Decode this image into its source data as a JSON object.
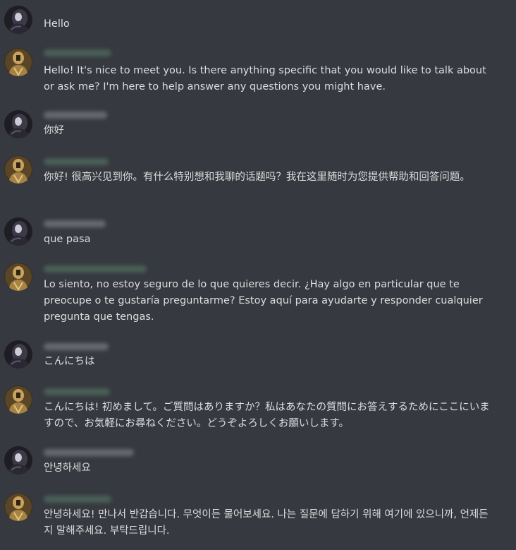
{
  "conversation": {
    "messages": [
      {
        "role": "user",
        "avatar_icon": "dark-hooded-figure-avatar",
        "text": "Hello"
      },
      {
        "role": "bot",
        "avatar_icon": "golden-armored-figure-avatar",
        "text": "Hello! It's nice to meet you. Is there anything specific that you would like to talk about or ask me? I'm here to help answer any questions you might have."
      },
      {
        "role": "user",
        "avatar_icon": "dark-hooded-figure-avatar",
        "text": "你好"
      },
      {
        "role": "bot",
        "avatar_icon": "golden-armored-figure-avatar",
        "text": "你好! 很高兴见到你。有什么特别想和我聊的话题吗？我在这里随时为您提供帮助和回答问题。"
      },
      {
        "role": "user",
        "avatar_icon": "dark-hooded-figure-avatar",
        "text": "que pasa"
      },
      {
        "role": "bot",
        "avatar_icon": "golden-armored-figure-avatar",
        "text": "Lo siento, no estoy seguro de lo que quieres decir. ¿Hay algo en particular que te preocupe o te gustaría preguntarme? Estoy aquí para ayudarte y responder cualquier pregunta que tengas."
      },
      {
        "role": "user",
        "avatar_icon": "dark-hooded-figure-avatar",
        "text": "こんにちは"
      },
      {
        "role": "bot",
        "avatar_icon": "golden-armored-figure-avatar",
        "text": "こんにちは! 初めまして。ご質問はありますか？私はあなたの質問にお答えするためにここにいますので、お気軽にお尋ねください。どうぞよろしくお願いします。"
      },
      {
        "role": "user",
        "avatar_icon": "dark-hooded-figure-avatar",
        "text": "안녕하세요"
      },
      {
        "role": "bot",
        "avatar_icon": "golden-armored-figure-avatar",
        "text": "안녕하세요! 만나서 반갑습니다. 무엇이든 물어보세요. 나는 질문에 답하기 위해 여기에 있으니까, 언제든지 말해주세요. 부탁드립니다."
      }
    ]
  },
  "colors": {
    "background": "#36393f",
    "text": "#dcddde",
    "username_blur_user": "#8e9297",
    "username_blur_bot": "#5b7f6a"
  }
}
